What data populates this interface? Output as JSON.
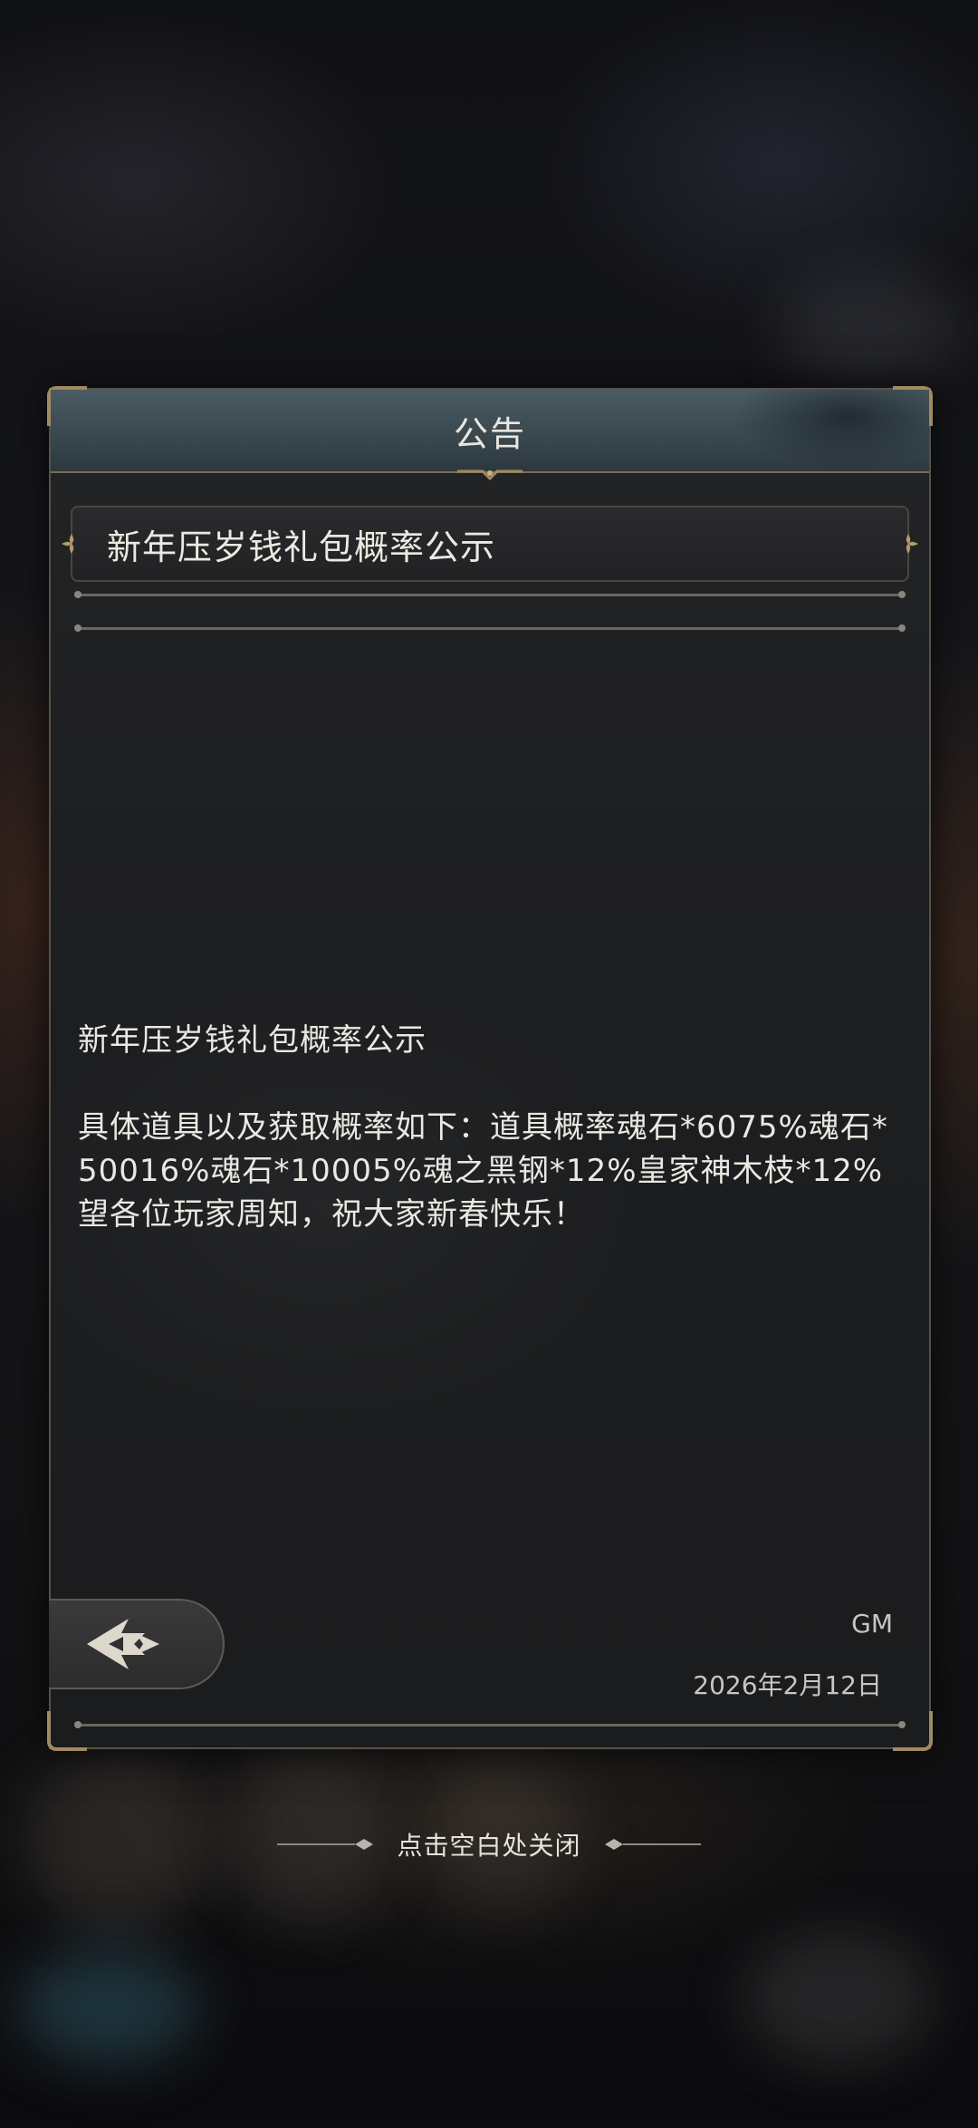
{
  "dialog": {
    "title": "公告"
  },
  "announcement": {
    "subject": "新年压岁钱礼包概率公示",
    "heading": "新年压岁钱礼包概率公示",
    "body": "具体道具以及获取概率如下：道具概率魂石*6075%魂石*50016%魂石*10005%魂之黑钢*12%皇家神木枝*12%望各位玩家周知，祝大家新春快乐！",
    "author": "GM",
    "date": "2026年2月12日"
  },
  "footer": {
    "close_hint": "点击空白处关闭"
  },
  "icons": {
    "back": "back-arrow-icon",
    "subject_left": "fleur-ornament-icon",
    "subject_right": "fleur-ornament-icon"
  },
  "colors": {
    "header": "#3a4950",
    "panel": "#1d1e20",
    "frame_gold": "#a08a62",
    "text": "#ebe8e2"
  }
}
